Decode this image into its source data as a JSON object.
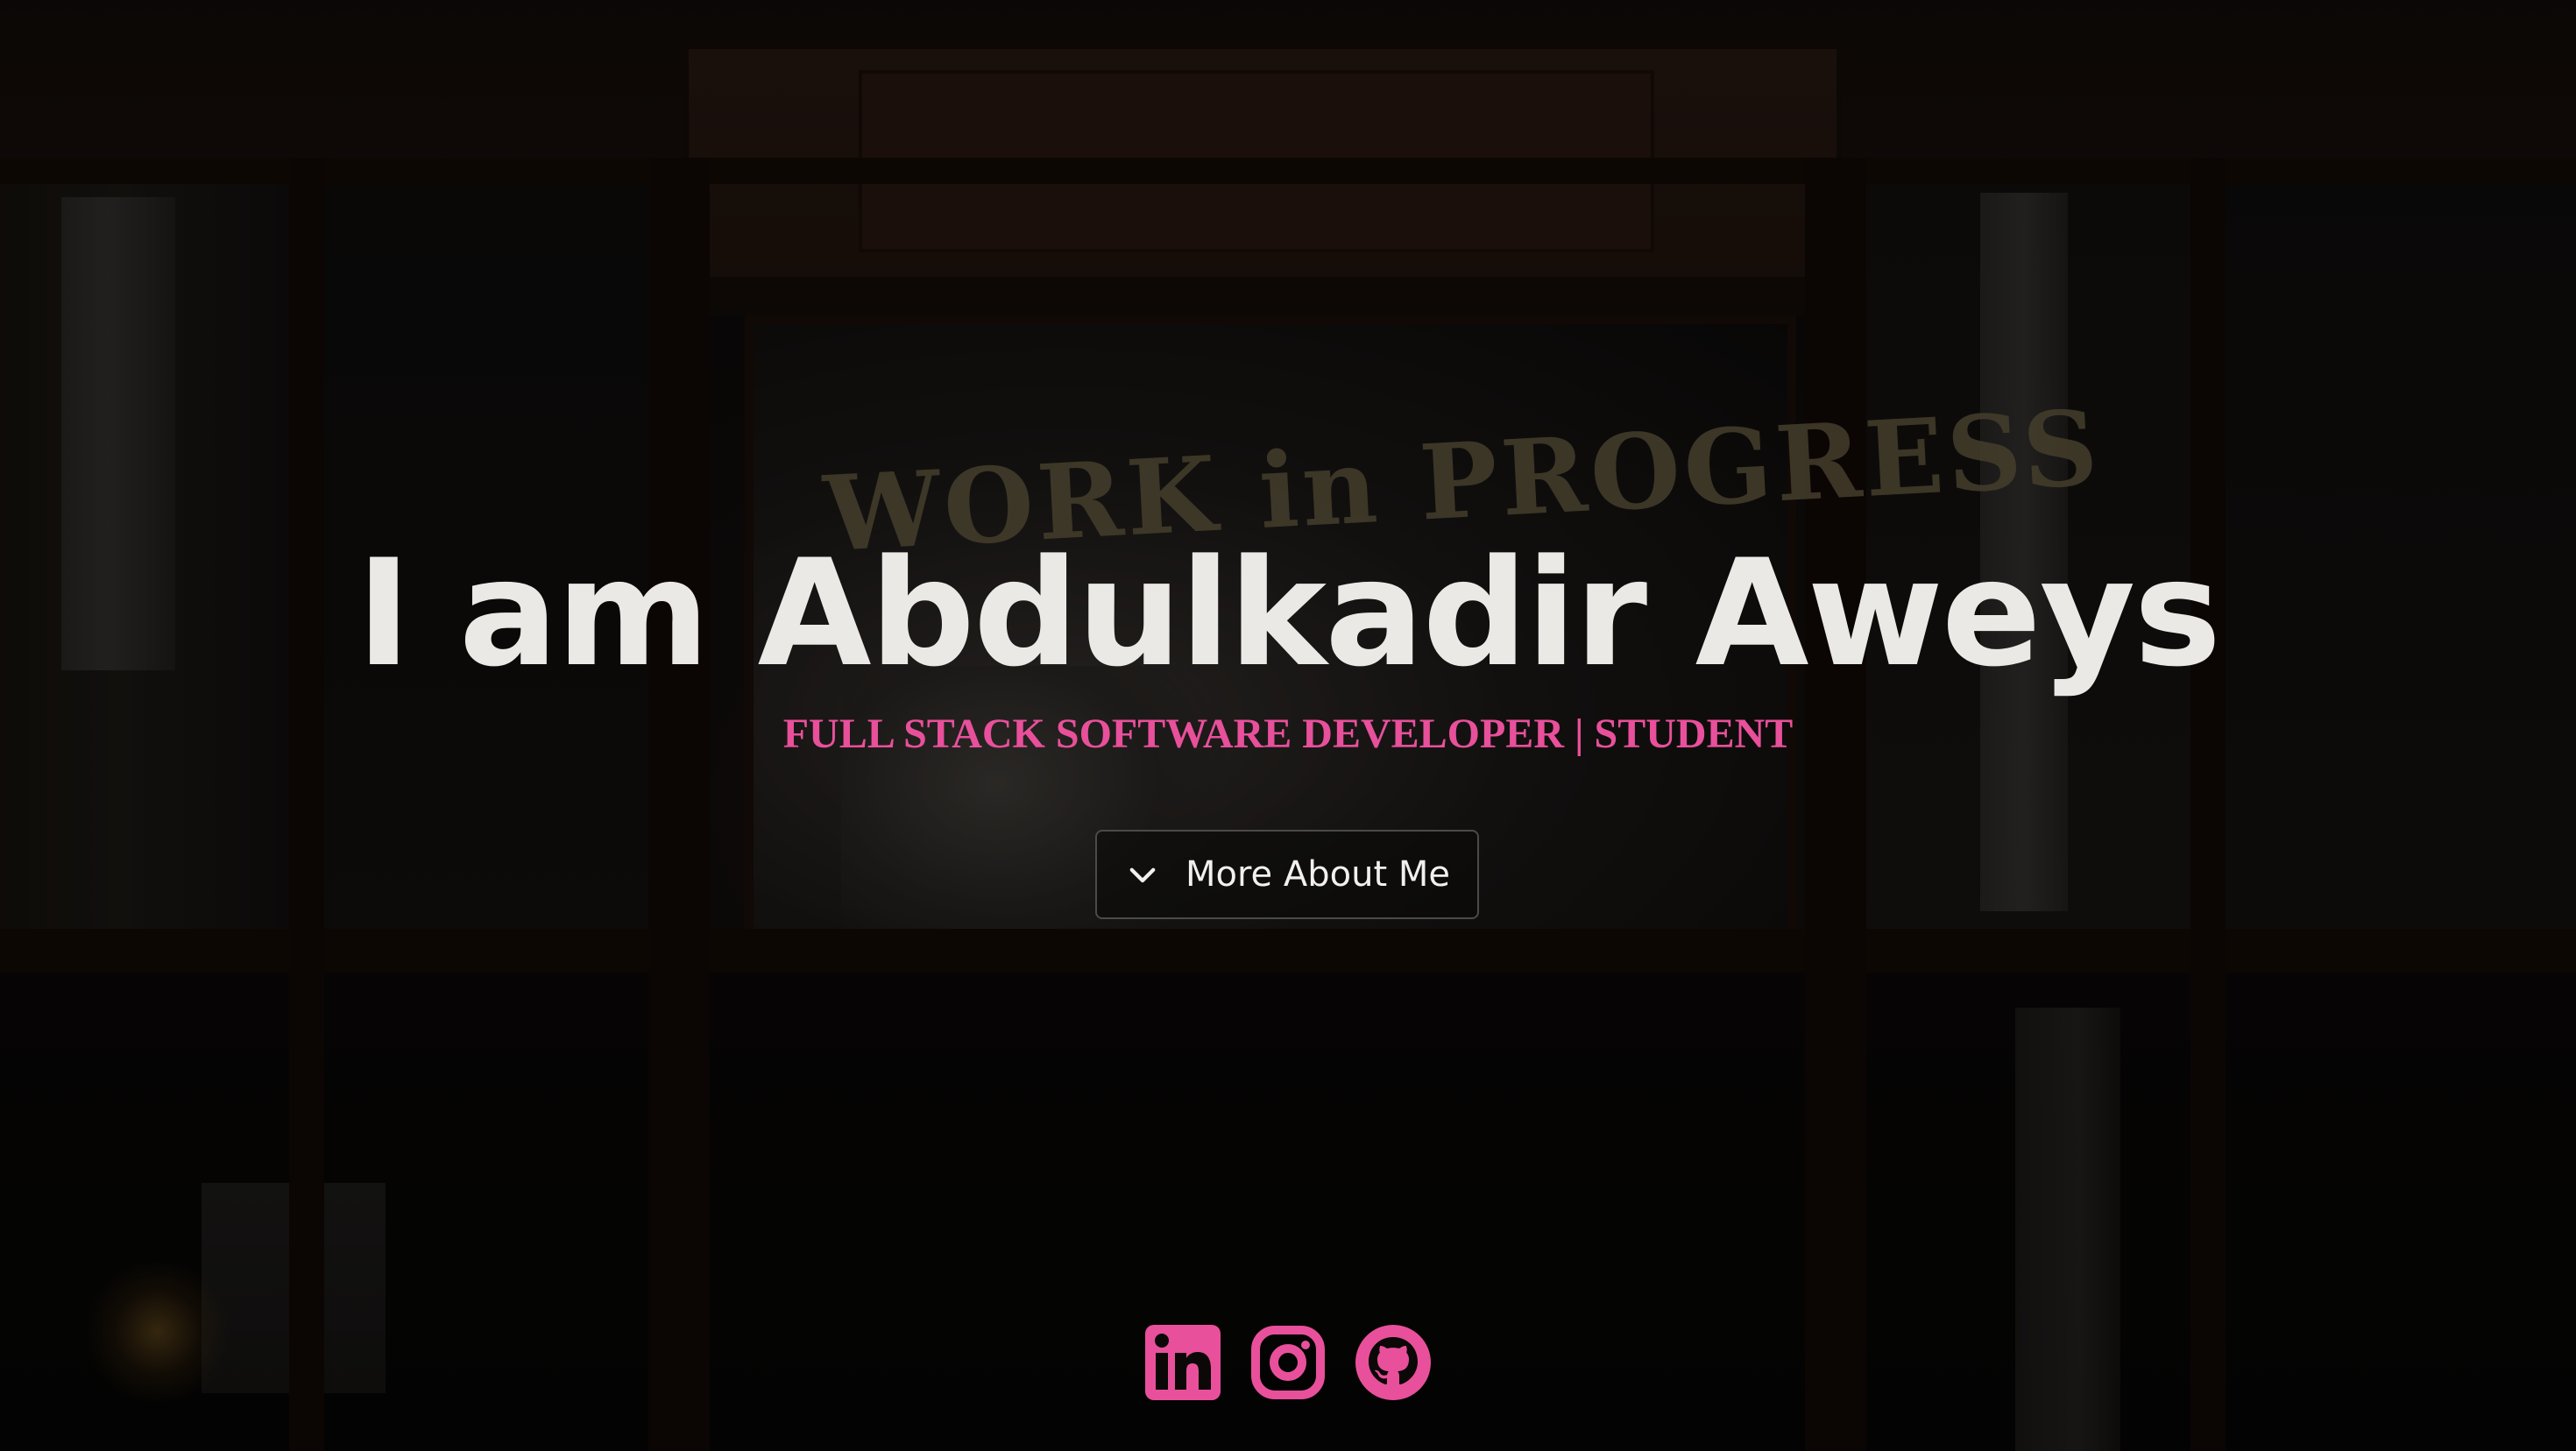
{
  "hero": {
    "title": "I am Abdulkadir Aweys",
    "subtitle": "FULL STACK SOFTWARE DEVELOPER | STUDENT",
    "more_button_label": "More About Me",
    "background_sign_text": "WORK in PROGRESS"
  },
  "socials": [
    {
      "name": "LinkedIn",
      "icon": "linkedin-icon"
    },
    {
      "name": "Instagram",
      "icon": "instagram-icon"
    },
    {
      "name": "GitHub",
      "icon": "github-icon"
    }
  ],
  "colors": {
    "accent": "#e8509b",
    "title": "#ebe9e6",
    "button_border": "#4c4a48",
    "background": "#0b0807"
  },
  "icons": {
    "more_button": "chevron-down-icon"
  }
}
